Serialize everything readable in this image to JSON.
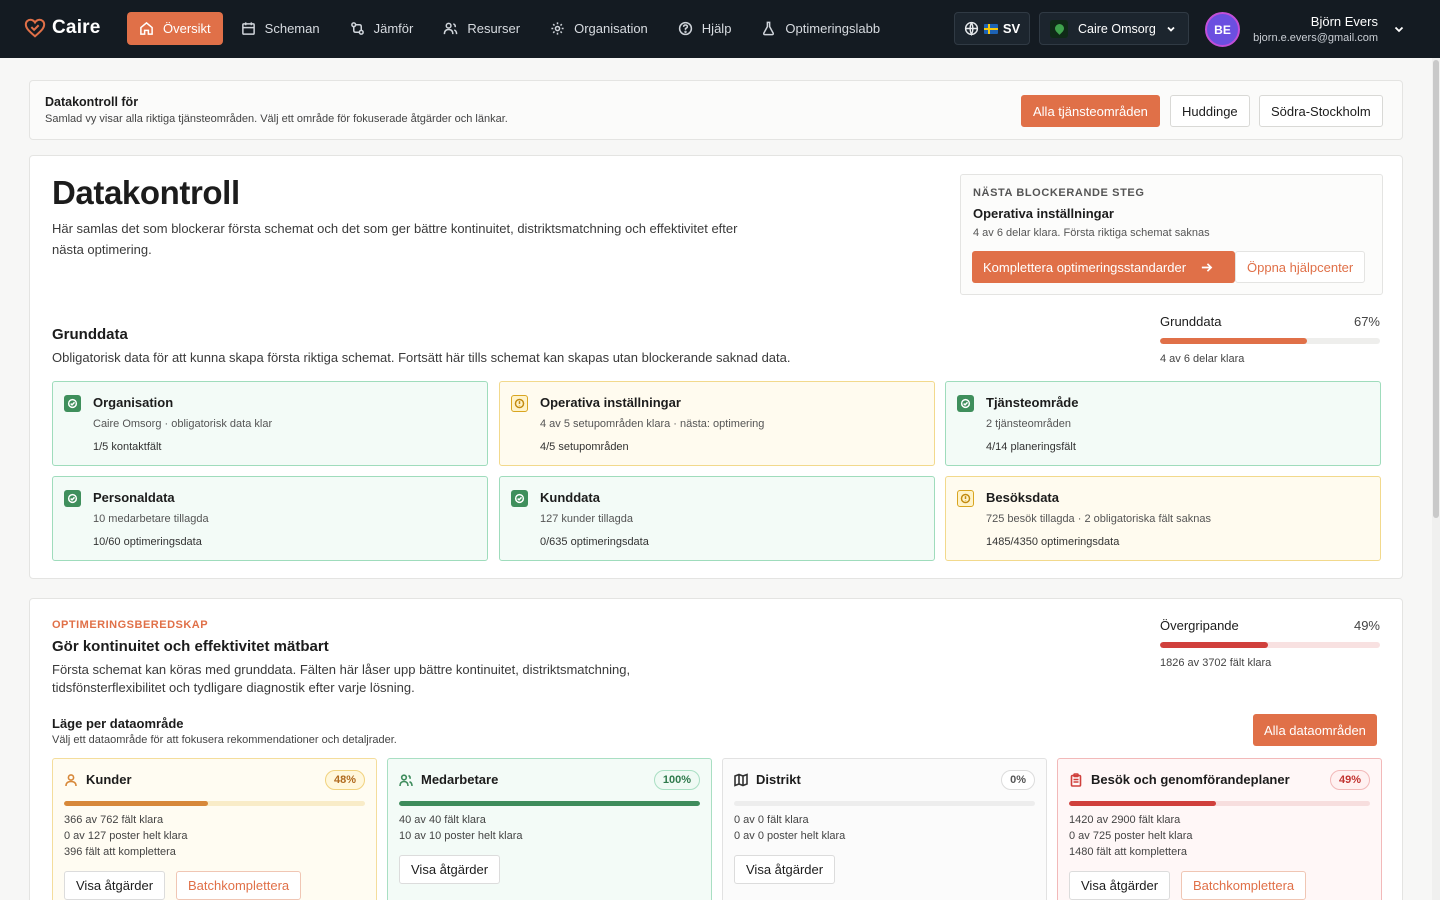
{
  "app": {
    "name": "Caire"
  },
  "nav": {
    "items": [
      {
        "label": "Översikt",
        "icon": "home-icon",
        "active": true
      },
      {
        "label": "Scheman",
        "icon": "calendar-icon"
      },
      {
        "label": "Jämför",
        "icon": "compare-icon"
      },
      {
        "label": "Resurser",
        "icon": "users-icon"
      },
      {
        "label": "Organisation",
        "icon": "gear-icon"
      },
      {
        "label": "Hjälp",
        "icon": "help-icon"
      },
      {
        "label": "Optimeringslabb",
        "icon": "flask-icon"
      }
    ],
    "language": "SV",
    "organization": "Caire Omsorg",
    "user": {
      "initials": "BE",
      "name": "Björn Evers",
      "email": "bjorn.e.evers@gmail.com"
    }
  },
  "filter": {
    "title": "Datakontroll för",
    "subtitle": "Samlad vy visar alla riktiga tjänsteområden. Välj ett område för fokuserade åtgärder och länkar.",
    "buttons": [
      "Alla tjänsteområden",
      "Huddinge",
      "Södra-Stockholm"
    ],
    "active_index": 0
  },
  "main": {
    "title": "Datakontroll",
    "lead": "Här samlas det som blockerar första schemat och det som ger bättre kontinuitet, distriktsmatchning och effektivitet efter nästa optimering.",
    "next_step": {
      "kicker": "NÄSTA BLOCKERANDE STEG",
      "title": "Operativa inställningar",
      "subtitle": "4 av 6 delar klara. Första riktiga schemat saknas",
      "primary_label": "Komplettera optimeringsstandarder",
      "secondary_label": "Öppna hjälpcenter"
    }
  },
  "grunddata": {
    "title": "Grunddata",
    "subtitle": "Obligatorisk data för att kunna skapa första riktiga schemat. Fortsätt här tills schemat kan skapas utan blockerande saknad data.",
    "progress": {
      "label": "Grunddata",
      "percent_label": "67%",
      "value": 0.67,
      "footer": "4 av 6 delar klara",
      "color": "#e07048",
      "track_color": "#eeeeec"
    },
    "tiles": [
      {
        "title": "Organisation",
        "status": "ok",
        "sub": "Caire Omsorg · obligatorisk data klar",
        "meta": "1/5 kontaktfält"
      },
      {
        "title": "Operativa inställningar",
        "status": "warn",
        "sub": "4 av 5 setupområden klara · nästa: optimering",
        "meta": "4/5 setupområden"
      },
      {
        "title": "Tjänsteområde",
        "status": "ok",
        "sub": "2 tjänsteområden",
        "meta": "4/14 planeringsfält"
      },
      {
        "title": "Personaldata",
        "status": "ok",
        "sub": "10 medarbetare tillagda",
        "meta": "10/60 optimeringsdata"
      },
      {
        "title": "Kunddata",
        "status": "ok",
        "sub": "127 kunder tillagda",
        "meta": "0/635 optimeringsdata"
      },
      {
        "title": "Besöksdata",
        "status": "warn",
        "sub": "725 besök tillagda · 2 obligatoriska fält saknas",
        "meta": "1485/4350 optimeringsdata"
      }
    ]
  },
  "readiness": {
    "kicker": "OPTIMERINGSBEREDSKAP",
    "title": "Gör kontinuitet och effektivitet mätbart",
    "lead": "Första schemat kan köras med grunddata. Fälten här låser upp bättre kontinuitet, distriktsmatchning, tidsfönsterflexibilitet och tydligare diagnostik efter varje lösning.",
    "progress": {
      "label": "Övergripande",
      "percent_label": "49%",
      "value": 0.49,
      "footer": "1826 av 3702 fält klara",
      "color": "#d0403c",
      "track_color": "#f8e1e1"
    },
    "mode_title": "Läge per dataområde",
    "mode_subtitle": "Välj ett dataområde för att fokusera rekommendationer och detaljrader.",
    "all_areas_label": "Alla dataområden",
    "areas": [
      {
        "title": "Kunder",
        "icon": "user-icon",
        "badge": "48%",
        "value": 0.48,
        "lines": [
          "366 av 762 fält klara",
          "0 av 127 poster helt klara",
          "396 fält att komplettera"
        ],
        "actions": [
          "Visa åtgärder",
          "Batchkomplettera"
        ],
        "color": "#d7883a",
        "track": "#f9ecc8",
        "badge_color": "#b06a1e",
        "badge_border": "#f1d27e",
        "badge_bg": "#fff7dc"
      },
      {
        "title": "Medarbetare",
        "icon": "team-icon",
        "badge": "100%",
        "value": 1.0,
        "lines": [
          "40 av 40 fält klara",
          "10 av 10 poster helt klara"
        ],
        "actions": [
          "Visa åtgärder"
        ],
        "color": "#3e8c5c",
        "track": "#dcefe4",
        "badge_color": "#2f7a4c",
        "badge_border": "#a9dfc3",
        "badge_bg": "#effaf4"
      },
      {
        "title": "Distrikt",
        "icon": "map-icon",
        "badge": "0%",
        "value": 0.0,
        "lines": [
          "0 av 0 fält klara",
          "0 av 0 poster helt klara"
        ],
        "actions": [
          "Visa åtgärder"
        ],
        "color": "#cfcfcf",
        "track": "#ededed",
        "badge_color": "#555555",
        "badge_border": "#dcdcdc",
        "badge_bg": "#ffffff"
      },
      {
        "title": "Besök och genomförandeplaner",
        "icon": "clipboard-icon",
        "badge": "49%",
        "value": 0.49,
        "lines": [
          "1420 av 2900 fält klara",
          "0 av 725 poster helt klara",
          "1480 fält att komplettera"
        ],
        "actions": [
          "Visa åtgärder",
          "Batchkomplettera"
        ],
        "color": "#d0403c",
        "track": "#f7dede",
        "badge_color": "#c23431",
        "badge_border": "#f2b9b9",
        "badge_bg": "#fff1f1"
      }
    ]
  }
}
